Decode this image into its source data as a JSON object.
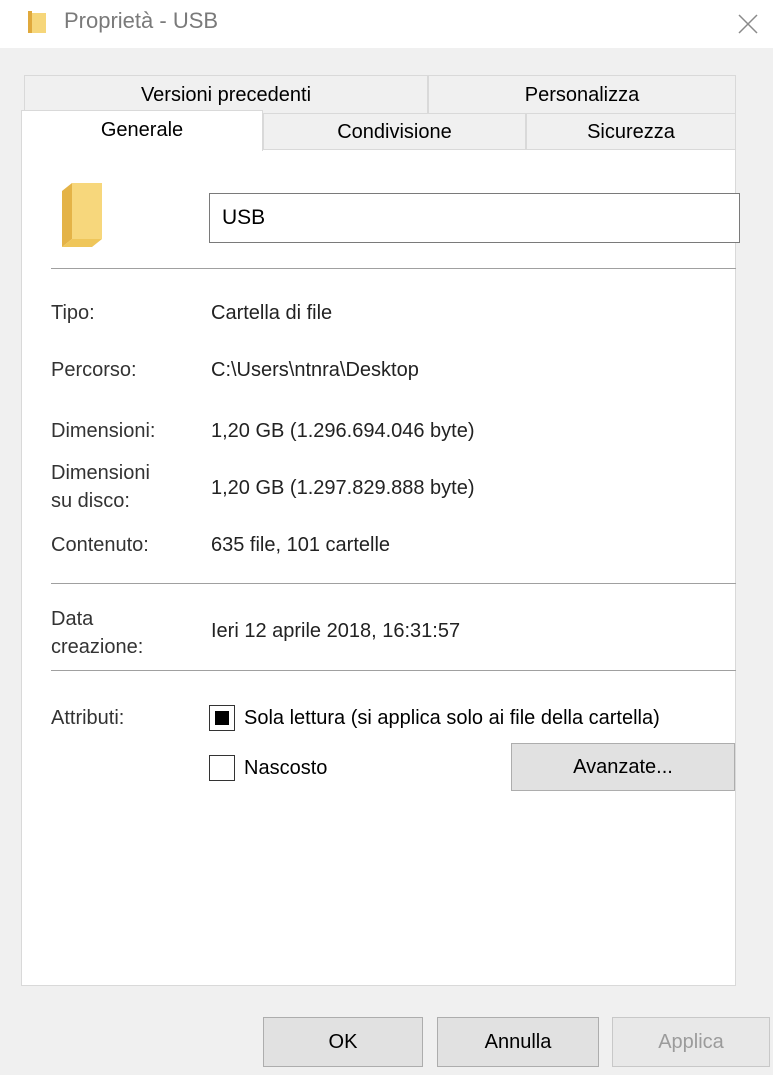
{
  "window": {
    "title": "Proprietà - USB",
    "close_glyph": "✕"
  },
  "tabs": {
    "row1": [
      "Versioni precedenti",
      "Personalizza"
    ],
    "row2": [
      "Generale",
      "Condivisione",
      "Sicurezza"
    ],
    "active": "Generale"
  },
  "general": {
    "name_value": "USB",
    "rows": [
      {
        "label": "Tipo:",
        "value": "Cartella di file"
      },
      {
        "label": "Percorso:",
        "value": "C:\\Users\\ntnra\\Desktop"
      },
      {
        "label": "Dimensioni:",
        "value": "1,20 GB (1.296.694.046 byte)"
      },
      {
        "label_line1": "Dimensioni",
        "label_line2": "su disco:",
        "value": "1,20 GB (1.297.829.888 byte)"
      },
      {
        "label": "Contenuto:",
        "value": "635 file, 101 cartelle"
      }
    ],
    "created": {
      "label_line1": "Data",
      "label_line2": "creazione:",
      "value": "Ieri 12 aprile 2018, 16:31:57"
    },
    "attributes": {
      "label": "Attributi:",
      "readonly_label": "Sola lettura (si applica solo ai file della cartella)",
      "readonly_state": "indeterminate",
      "hidden_label": "Nascosto",
      "hidden_checked": false,
      "advanced_button": "Avanzate..."
    }
  },
  "buttons": {
    "ok": "OK",
    "cancel": "Annulla",
    "apply": "Applica",
    "apply_enabled": false
  },
  "icons": {
    "title_icon": "folder-icon",
    "folder_icon": "folder-icon",
    "folder_color": "#f6d67a"
  }
}
